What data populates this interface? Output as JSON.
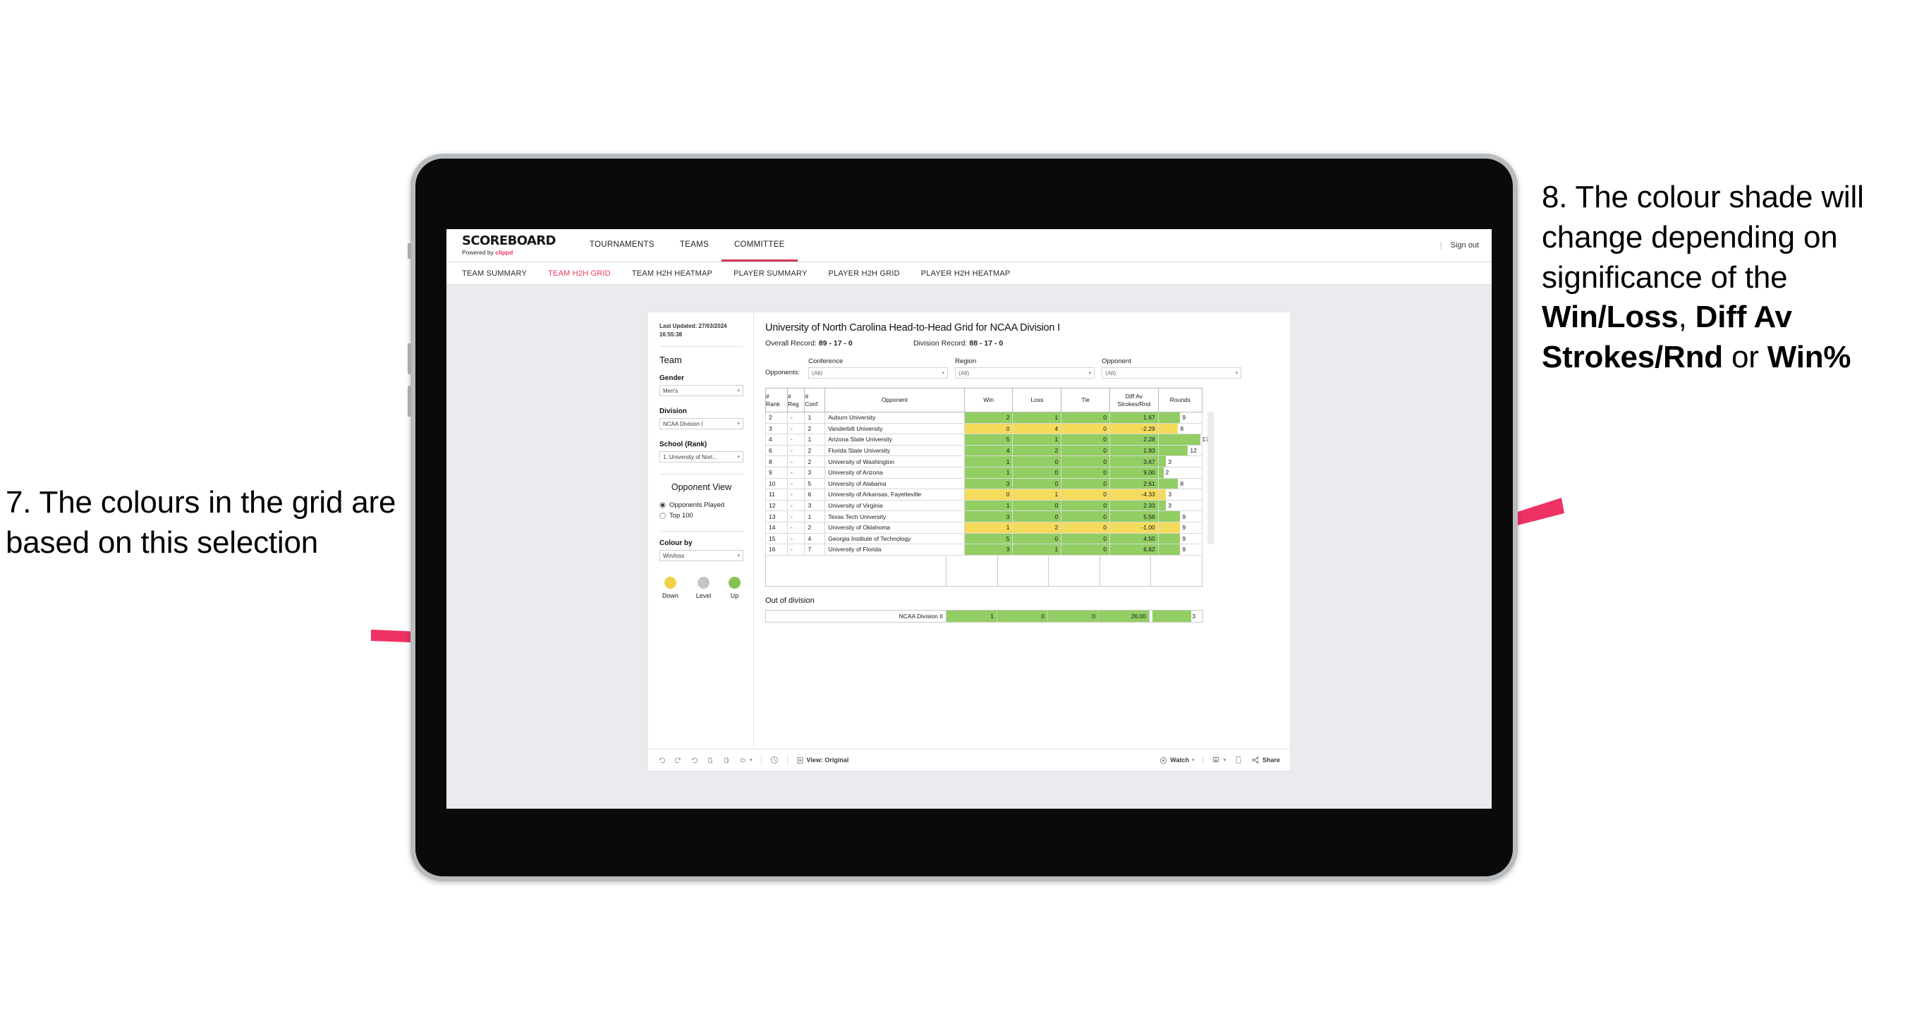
{
  "annotations": {
    "left": "7. The colours in the grid are based on this selection",
    "right_pre": "8. The colour shade will change depending on significance of the ",
    "right_b1": "Win/Loss",
    "right_mid1": ", ",
    "right_b2": "Diff Av Strokes/Rnd",
    "right_mid2": " or ",
    "right_b3": "Win%",
    "arrow_color": "#ee3364"
  },
  "app": {
    "brand": {
      "title": "SCOREBOARD",
      "powered_by": "Powered by ",
      "clippd": "clippd"
    },
    "top_nav": [
      {
        "label": "TOURNAMENTS",
        "active": false
      },
      {
        "label": "TEAMS",
        "active": false
      },
      {
        "label": "COMMITTEE",
        "active": true
      }
    ],
    "sign_out": "Sign out",
    "divider": "|",
    "sub_nav": [
      {
        "label": "TEAM SUMMARY",
        "active": false
      },
      {
        "label": "TEAM H2H GRID",
        "active": true
      },
      {
        "label": "TEAM H2H HEATMAP",
        "active": false
      },
      {
        "label": "PLAYER SUMMARY",
        "active": false
      },
      {
        "label": "PLAYER H2H GRID",
        "active": false
      },
      {
        "label": "PLAYER H2H HEATMAP",
        "active": false
      }
    ]
  },
  "sidebar": {
    "last_updated": "Last Updated: 27/03/2024 16:55:38",
    "team_heading": "Team",
    "gender": {
      "label": "Gender",
      "value": "Men's"
    },
    "division": {
      "label": "Division",
      "value": "NCAA Division I"
    },
    "school": {
      "label": "School (Rank)",
      "value": "1. University of Nort..."
    },
    "opponent_view": {
      "heading": "Opponent View",
      "options": [
        {
          "label": "Opponents Played",
          "selected": true
        },
        {
          "label": "Top 100",
          "selected": false
        }
      ]
    },
    "colour_by": {
      "label": "Colour by",
      "value": "Win/loss"
    },
    "legend": [
      {
        "label": "Down",
        "color": "#f2d045"
      },
      {
        "label": "Level",
        "color": "#c2c6cb"
      },
      {
        "label": "Up",
        "color": "#84c254"
      }
    ]
  },
  "main": {
    "title": "University of North Carolina Head-to-Head Grid for NCAA Division I",
    "overall_record_label": "Overall Record: ",
    "overall_record": "89 - 17 - 0",
    "division_record_label": "Division Record: ",
    "division_record": "88 - 17 - 0",
    "opponents_label": "Opponents:",
    "filters": [
      {
        "label": "Conference",
        "value": "(All)"
      },
      {
        "label": "Region",
        "value": "(All)"
      },
      {
        "label": "Opponent",
        "value": "(All)"
      }
    ],
    "columns": [
      "# Rank",
      "# Reg",
      "# Conf",
      "Opponent",
      "Win",
      "Loss",
      "Tie",
      "Diff Av Strokes/Rnd",
      "Rounds"
    ],
    "columns_split": [
      [
        "#",
        "Rank"
      ],
      [
        "#",
        "Reg"
      ],
      [
        "#",
        "Conf"
      ],
      [
        "Opponent",
        ""
      ],
      [
        "Win",
        ""
      ],
      [
        "Loss",
        ""
      ],
      [
        "Tie",
        ""
      ],
      [
        "Diff Av",
        "Strokes/Rnd"
      ],
      [
        "Rounds",
        ""
      ]
    ],
    "out_of_division_heading": "Out of division",
    "out_of_division_row": {
      "label": "NCAA Division II",
      "win": "1",
      "loss": "0",
      "tie": "0",
      "diff": "26.00",
      "rounds": "3",
      "color": "#92ce63",
      "bar_pct": 82
    },
    "colors": {
      "up": "#92ce63",
      "down": "#f5db5c"
    }
  },
  "chart_data": {
    "type": "table",
    "title": "University of North Carolina Head-to-Head Grid for NCAA Division I",
    "columns": [
      "# Rank",
      "# Reg",
      "# Conf",
      "Opponent",
      "Win",
      "Loss",
      "Tie",
      "Diff Av Strokes/Rnd",
      "Rounds"
    ],
    "rows": [
      {
        "rank": "2",
        "reg": "-",
        "conf": "1",
        "opponent": "Auburn University",
        "win": "2",
        "loss": "1",
        "tie": "0",
        "diff": "1.67",
        "rounds": "9",
        "color": "#92ce63",
        "bar_pct": 50
      },
      {
        "rank": "3",
        "reg": "-",
        "conf": "2",
        "opponent": "Vanderbilt University",
        "win": "0",
        "loss": "4",
        "tie": "0",
        "diff": "-2.29",
        "rounds": "8",
        "color": "#f5db5c",
        "bar_pct": 45
      },
      {
        "rank": "4",
        "reg": "-",
        "conf": "1",
        "opponent": "Arizona State University",
        "win": "5",
        "loss": "1",
        "tie": "0",
        "diff": "2.28",
        "rounds": "17",
        "color": "#92ce63",
        "bar_pct": 96
      },
      {
        "rank": "6",
        "reg": "-",
        "conf": "2",
        "opponent": "Florida State University",
        "win": "4",
        "loss": "2",
        "tie": "0",
        "diff": "1.83",
        "rounds": "12",
        "color": "#92ce63",
        "bar_pct": 68
      },
      {
        "rank": "8",
        "reg": "-",
        "conf": "2",
        "opponent": "University of Washington",
        "win": "1",
        "loss": "0",
        "tie": "0",
        "diff": "3.67",
        "rounds": "3",
        "color": "#92ce63",
        "bar_pct": 17
      },
      {
        "rank": "9",
        "reg": "-",
        "conf": "3",
        "opponent": "University of Arizona",
        "win": "1",
        "loss": "0",
        "tie": "0",
        "diff": "9.00",
        "rounds": "2",
        "color": "#92ce63",
        "bar_pct": 11
      },
      {
        "rank": "10",
        "reg": "-",
        "conf": "5",
        "opponent": "University of Alabama",
        "win": "3",
        "loss": "0",
        "tie": "0",
        "diff": "2.61",
        "rounds": "8",
        "color": "#92ce63",
        "bar_pct": 45
      },
      {
        "rank": "11",
        "reg": "-",
        "conf": "6",
        "opponent": "University of Arkansas, Fayetteville",
        "win": "0",
        "loss": "1",
        "tie": "0",
        "diff": "-4.33",
        "rounds": "3",
        "color": "#f5db5c",
        "bar_pct": 17
      },
      {
        "rank": "12",
        "reg": "-",
        "conf": "3",
        "opponent": "University of Virginia",
        "win": "1",
        "loss": "0",
        "tie": "0",
        "diff": "2.33",
        "rounds": "3",
        "color": "#92ce63",
        "bar_pct": 17
      },
      {
        "rank": "13",
        "reg": "-",
        "conf": "1",
        "opponent": "Texas Tech University",
        "win": "3",
        "loss": "0",
        "tie": "0",
        "diff": "5.56",
        "rounds": "9",
        "color": "#92ce63",
        "bar_pct": 50
      },
      {
        "rank": "14",
        "reg": "-",
        "conf": "2",
        "opponent": "University of Oklahoma",
        "win": "1",
        "loss": "2",
        "tie": "0",
        "diff": "-1.00",
        "rounds": "9",
        "color": "#f5db5c",
        "bar_pct": 50
      },
      {
        "rank": "15",
        "reg": "-",
        "conf": "4",
        "opponent": "Georgia Institute of Technology",
        "win": "5",
        "loss": "0",
        "tie": "0",
        "diff": "4.50",
        "rounds": "9",
        "color": "#92ce63",
        "bar_pct": 50
      },
      {
        "rank": "16",
        "reg": "-",
        "conf": "7",
        "opponent": "University of Florida",
        "win": "3",
        "loss": "1",
        "tie": "0",
        "diff": "6.62",
        "rounds": "9",
        "color": "#92ce63",
        "bar_pct": 50
      }
    ],
    "out_of_division": [
      {
        "opponent": "NCAA Division II",
        "win": "1",
        "loss": "0",
        "tie": "0",
        "diff": "26.00",
        "rounds": "3",
        "color": "#92ce63"
      }
    ]
  },
  "footer": {
    "view_label": "View: Original",
    "watch_label": "Watch",
    "share_label": "Share",
    "caret": "▾"
  }
}
